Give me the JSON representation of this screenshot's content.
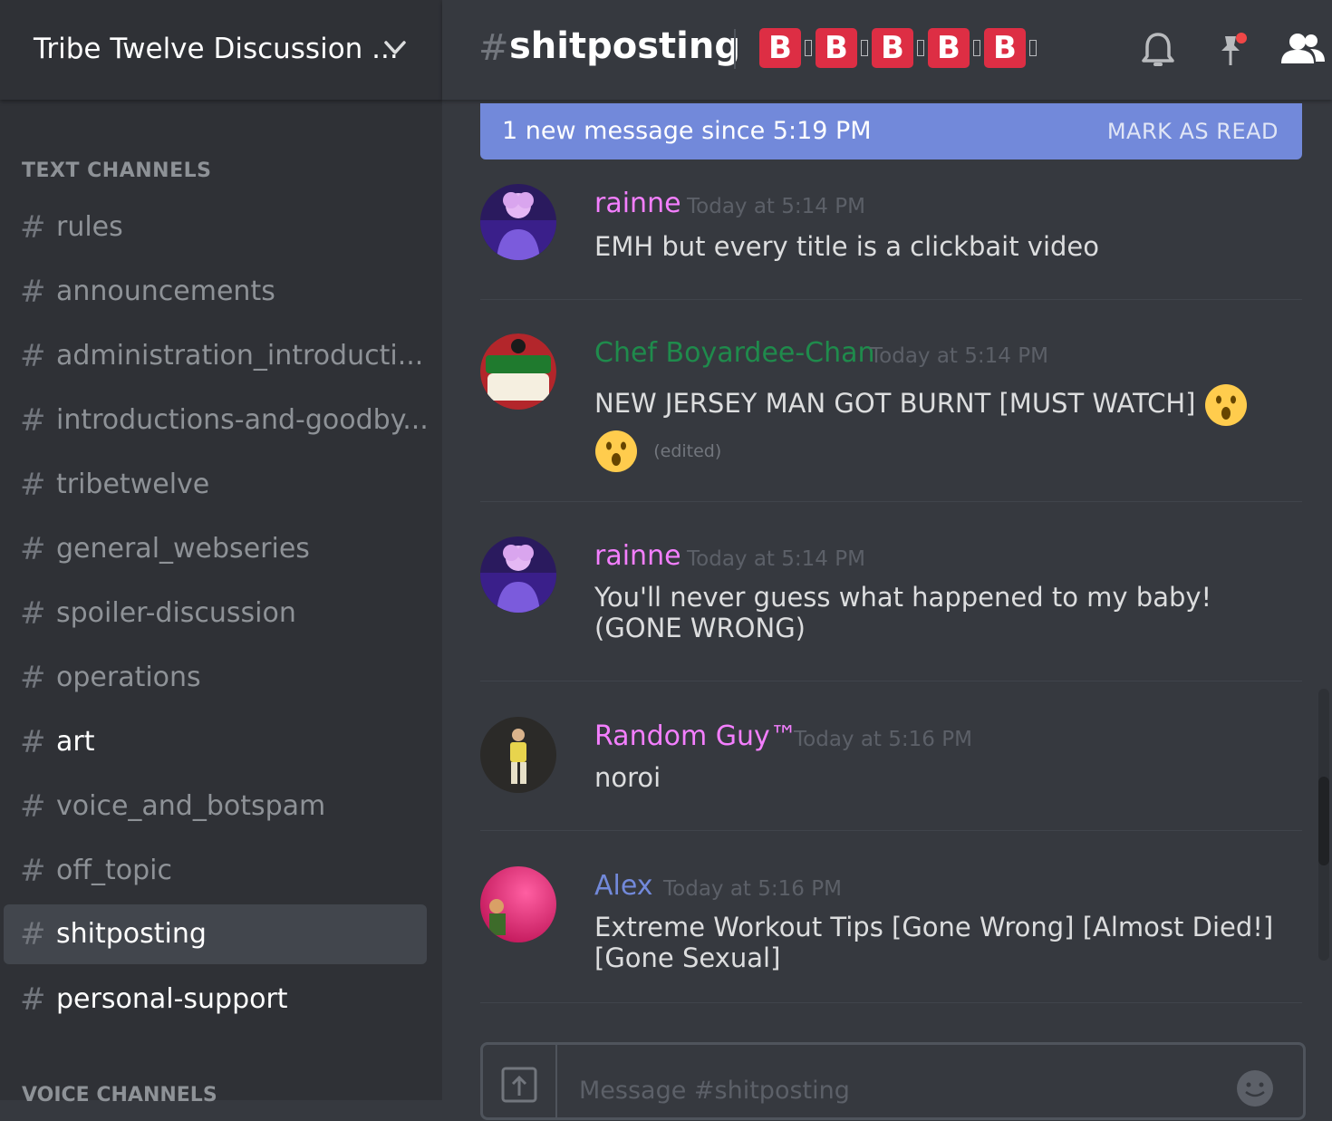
{
  "server": {
    "name": "Tribe Twelve Discussion ..."
  },
  "sidebar": {
    "section_label": "TEXT CHANNELS",
    "voice_label": "VOICE CHANNELS",
    "channels": [
      {
        "name": "rules"
      },
      {
        "name": "announcements"
      },
      {
        "name": "administration_introducti..."
      },
      {
        "name": "introductions-and-goodby..."
      },
      {
        "name": "tribetwelve"
      },
      {
        "name": "general_webseries"
      },
      {
        "name": "spoiler-discussion"
      },
      {
        "name": "operations"
      },
      {
        "name": "art"
      },
      {
        "name": "voice_and_botspam"
      },
      {
        "name": "off_topic"
      },
      {
        "name": "shitposting",
        "active": true
      },
      {
        "name": "personal-support"
      }
    ]
  },
  "header": {
    "hash": "#",
    "channel": "shitposting",
    "topic_letters": [
      "B",
      "B",
      "B",
      "B",
      "B"
    ]
  },
  "banner": {
    "text": "1 new message since 5:19 PM",
    "action": "MARK AS READ"
  },
  "messages": [
    {
      "author": "rainne",
      "color": "#f47fff",
      "time": "Today at 5:14 PM",
      "content": "EMH but every title is a clickbait video"
    },
    {
      "author": "Chef Boyardee-Chan",
      "color": "#1f8b4c",
      "time": "Today at 5:14 PM",
      "content": "NEW JERSEY MAN GOT BURNT [MUST WATCH]",
      "edited": "(edited)",
      "emoji": "hushed-face"
    },
    {
      "author": "rainne",
      "color": "#f47fff",
      "time": "Today at 5:14 PM",
      "content": "You'll never guess what happened to my baby! (GONE WRONG)"
    },
    {
      "author": "Random Guy™",
      "color": "#f47fff",
      "time": "Today at 5:16 PM",
      "content": "noroi"
    },
    {
      "author": "Alex",
      "color": "#7289da",
      "time": "Today at 5:16 PM",
      "content": "Extreme Workout Tips [Gone Wrong] [Almost Died!] [Gone Sexual]"
    }
  ],
  "input": {
    "placeholder": "Message #shitposting"
  },
  "colors": {
    "accent": "#7289da",
    "background": "#36393f",
    "sidebar": "#2f3136",
    "badge": "#dd2e44"
  }
}
